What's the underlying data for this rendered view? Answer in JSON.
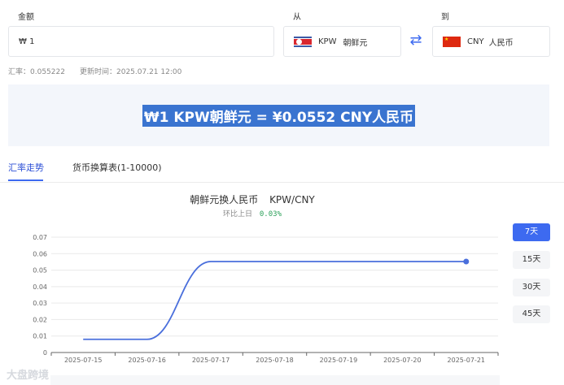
{
  "converter": {
    "amount_label": "金额",
    "amount_value": "₩ 1",
    "from_label": "从",
    "from_code": "KPW",
    "from_name": "朝鲜元",
    "to_label": "到",
    "to_code": "CNY",
    "to_name": "人民币"
  },
  "meta": {
    "rate_text": "汇率：0.055222",
    "updated_text": "更新时间：2025.07.21 12:00"
  },
  "result": {
    "text": "₩1 KPW朝鲜元 = ¥0.0552 CNY人民币"
  },
  "tabs": [
    {
      "label": "汇率走势",
      "active": true
    },
    {
      "label": "货币换算表(1-10000)",
      "active": false
    }
  ],
  "chart_header": {
    "title": "朝鲜元换人民币",
    "pair": "KPW/CNY",
    "change_label": "环比上日",
    "change_value": "0.03%"
  },
  "range_buttons": [
    {
      "label": "7天",
      "active": true
    },
    {
      "label": "15天",
      "active": false
    },
    {
      "label": "30天",
      "active": false
    },
    {
      "label": "45天",
      "active": false
    }
  ],
  "chart_data": {
    "type": "line",
    "x": [
      "2025-07-15",
      "2025-07-16",
      "2025-07-17",
      "2025-07-18",
      "2025-07-19",
      "2025-07-20",
      "2025-07-21"
    ],
    "series": [
      {
        "values": [
          0.008,
          0.008,
          0.0552,
          0.0552,
          0.0552,
          0.0552,
          0.0552
        ]
      }
    ],
    "ylim": [
      0,
      0.07
    ],
    "yticks": [
      "0",
      "0.01",
      "0.02",
      "0.03",
      "0.04",
      "0.05",
      "0.06",
      "0.07"
    ],
    "grid": true,
    "line_color": "#4a6fdc"
  },
  "watermark": "大盘跨境"
}
